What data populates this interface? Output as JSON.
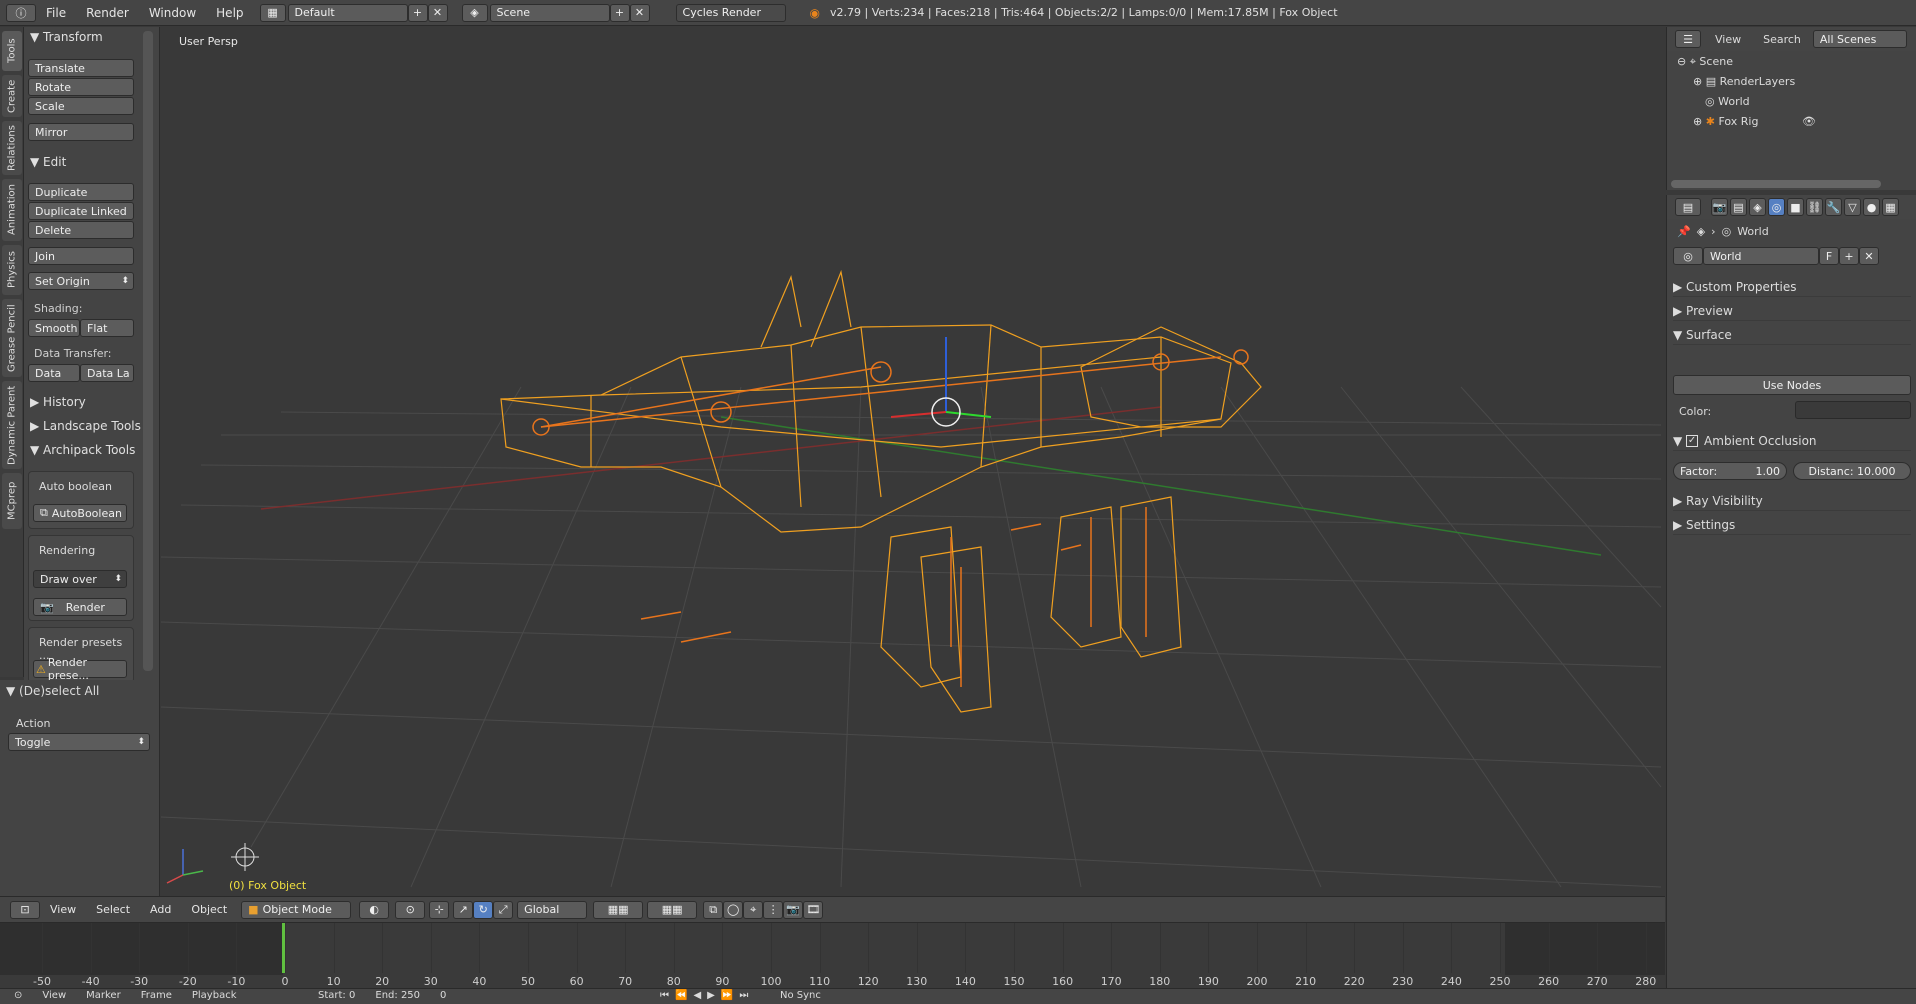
{
  "topbar": {
    "menus": [
      "File",
      "Render",
      "Window",
      "Help"
    ],
    "layout_name": "Default",
    "scene_name": "Scene",
    "render_engine": "Cycles Render",
    "stats": "v2.79 | Verts:234 | Faces:218 | Tris:464 | Objects:2/2 | Lamps:0/0 | Mem:17.85M | Fox Object"
  },
  "vtabs": [
    "Tools",
    "Create",
    "Relations",
    "Animation",
    "Physics",
    "Grease Pencil",
    "Dynamic Parent",
    "MCprep"
  ],
  "toolshelf": {
    "transform": {
      "title": "Transform",
      "buttons": [
        "Translate",
        "Rotate",
        "Scale",
        "Mirror"
      ]
    },
    "edit": {
      "title": "Edit",
      "buttons": [
        "Duplicate",
        "Duplicate Linked",
        "Delete",
        "Join",
        "Set Origin"
      ]
    },
    "shading_label": "Shading:",
    "shading": [
      "Smooth",
      "Flat"
    ],
    "data_transfer_label": "Data Transfer:",
    "data_transfer": [
      "Data",
      "Data La"
    ],
    "history": "History",
    "landscape": "Landscape Tools",
    "archipack": "Archipack Tools",
    "auto_boolean_label": "Auto boolean",
    "auto_boolean_btn": "AutoBoolean",
    "rendering_label": "Rendering",
    "draw_over": "Draw over",
    "render_btn": "Render",
    "render_presets_label": "Render presets ...",
    "render_presets_btn": "Render prese..."
  },
  "operator": {
    "title": "(De)select All",
    "action_label": "Action",
    "action_value": "Toggle"
  },
  "viewport": {
    "label": "User Persp",
    "object_label": "(0) Fox Object"
  },
  "outliner": {
    "menus": [
      "View",
      "Search"
    ],
    "scope": "All Scenes",
    "tree": [
      "Scene",
      "RenderLayers",
      "World",
      "Fox Rig"
    ]
  },
  "properties": {
    "context": "World",
    "datablock": "World",
    "fake_user": "F",
    "panels": {
      "custom_properties": "Custom Properties",
      "preview": "Preview",
      "surface": "Surface",
      "use_nodes": "Use Nodes",
      "color_label": "Color:",
      "ambient_occlusion": "Ambient Occlusion",
      "factor": "Factor:",
      "factor_value": "1.00",
      "distance": "Distanc: 10.000",
      "ray_visibility": "Ray Visibility",
      "settings": "Settings"
    }
  },
  "viewheader": {
    "menus": [
      "View",
      "Select",
      "Add",
      "Object"
    ],
    "mode": "Object Mode",
    "orientation": "Global"
  },
  "timeline": {
    "ticks": [
      "-50",
      "-40",
      "-30",
      "-20",
      "-10",
      "0",
      "10",
      "20",
      "30",
      "40",
      "50",
      "60",
      "70",
      "80",
      "90",
      "100",
      "110",
      "120",
      "130",
      "140",
      "150",
      "160",
      "170",
      "180",
      "190",
      "200",
      "210",
      "220",
      "230",
      "240",
      "250",
      "260",
      "270",
      "280"
    ],
    "current_frame": "0"
  },
  "timeheader": {
    "menus": [
      "View",
      "Marker",
      "Frame",
      "Playback"
    ],
    "start_label": "Start:",
    "start_value": "0",
    "end_label": "End:",
    "end_value": "250",
    "current": "0",
    "sync": "No Sync"
  },
  "colors": {
    "accent": "#5680c2",
    "wire": "#f0a020",
    "bone": "#e8741c",
    "x_axis": "#a03030",
    "y_axis": "#3a9a3a"
  }
}
